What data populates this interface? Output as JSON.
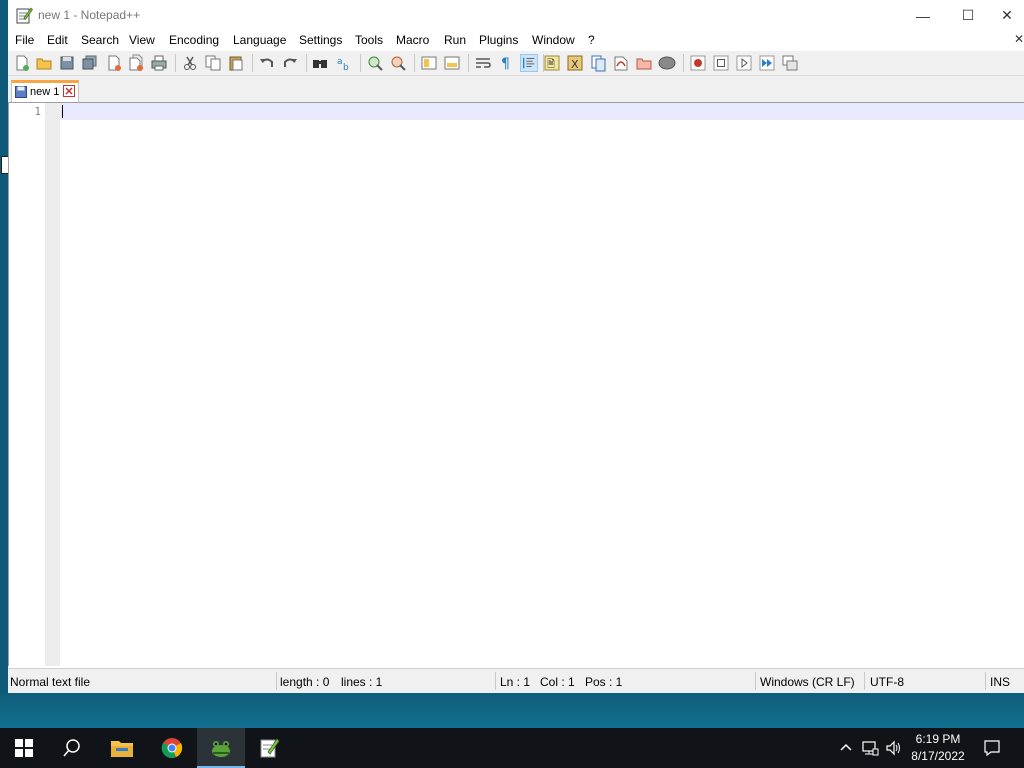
{
  "window": {
    "title": "new 1 - Notepad++",
    "minimize_glyph": "—",
    "maximize_glyph": "☐",
    "close_glyph": "✕"
  },
  "menu": {
    "items": [
      "File",
      "Edit",
      "Search",
      "View",
      "Encoding",
      "Language",
      "Settings",
      "Tools",
      "Macro",
      "Run",
      "Plugins",
      "Window",
      "?"
    ],
    "close_glyph": "✕"
  },
  "tabs": [
    {
      "label": "new 1"
    }
  ],
  "editor": {
    "line_numbers": [
      "1"
    ]
  },
  "status": {
    "file_type": "Normal text file",
    "length": "length : 0",
    "lines": "lines : 1",
    "ln": "Ln : 1",
    "col": "Col : 1",
    "pos": "Pos : 1",
    "eol": "Windows (CR LF)",
    "encoding": "UTF-8",
    "mode": "INS"
  },
  "taskbar": {
    "time": "6:19 PM",
    "date": "8/17/2022"
  },
  "colors": {
    "tab_accent": "#f7a541",
    "current_line": "#e8e8ff",
    "taskbar": "#101418",
    "taskbar_active_underline": "#76b9ed"
  },
  "icons": {
    "app": "notepadpp-icon",
    "toolbar": [
      "new-file-icon",
      "open-file-icon",
      "save-icon",
      "save-all-icon",
      "close-icon",
      "close-all-icon",
      "print-icon",
      "cut-icon",
      "copy-icon",
      "paste-icon",
      "undo-icon",
      "redo-icon",
      "find-icon",
      "replace-icon",
      "zoom-in-icon",
      "zoom-out-icon",
      "sync-vertical-icon",
      "sync-horizontal-icon",
      "word-wrap-icon",
      "show-all-chars-icon",
      "indent-guide-icon",
      "udl-icon",
      "doc-map-icon",
      "function-list-icon",
      "folder-as-workspace-icon",
      "doc-list-icon",
      "monitoring-icon",
      "record-macro-icon",
      "stop-macro-icon",
      "play-macro-icon",
      "run-macro-multiple-icon",
      "save-macro-icon"
    ]
  }
}
